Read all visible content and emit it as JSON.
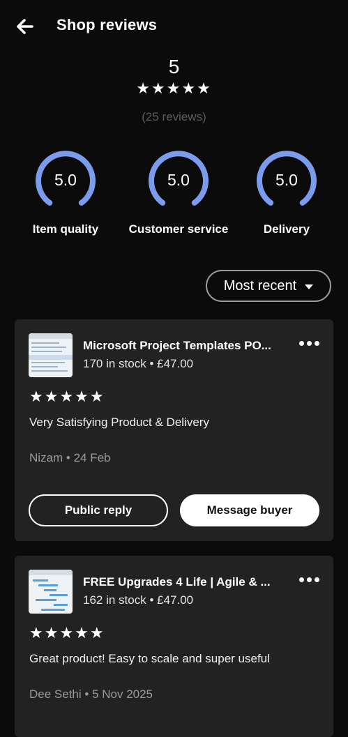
{
  "header": {
    "title": "Shop reviews",
    "back_icon": "arrow-left-icon"
  },
  "summary": {
    "rating": "5",
    "stars": "★★★★★",
    "star_rating": 5,
    "review_count": "(25 reviews)"
  },
  "gauges": [
    {
      "value": "5.0",
      "label": "Item quality",
      "level": 1.0
    },
    {
      "value": "5.0",
      "label": "Customer service",
      "level": 1.0
    },
    {
      "value": "5.0",
      "label": "Delivery",
      "level": 1.0
    }
  ],
  "sort": {
    "label": "Most recent",
    "icon": "caret-down-icon"
  },
  "reviews": [
    {
      "product_title": "Microsoft Project Templates PO...",
      "product_meta": "170 in stock • £47.00",
      "stars": "★★★★★",
      "star_rating": 5,
      "text": "Very Satisfying Product & Delivery",
      "reviewer": "Nizam • 24 Feb",
      "reply_label": "Public reply",
      "message_label": "Message buyer"
    },
    {
      "product_title": "FREE Upgrades 4 Life | Agile & ...",
      "product_meta": "162 in stock • £47.00",
      "stars": "★★★★★",
      "star_rating": 5,
      "text": "Great product! Easy to scale and super useful",
      "reviewer": "Dee Sethi • 5 Nov 2025"
    }
  ],
  "colors": {
    "background": "#0b0b0b",
    "card": "#222222",
    "gauge_arc": "#7b9bec",
    "muted": "#9a9a9a"
  }
}
